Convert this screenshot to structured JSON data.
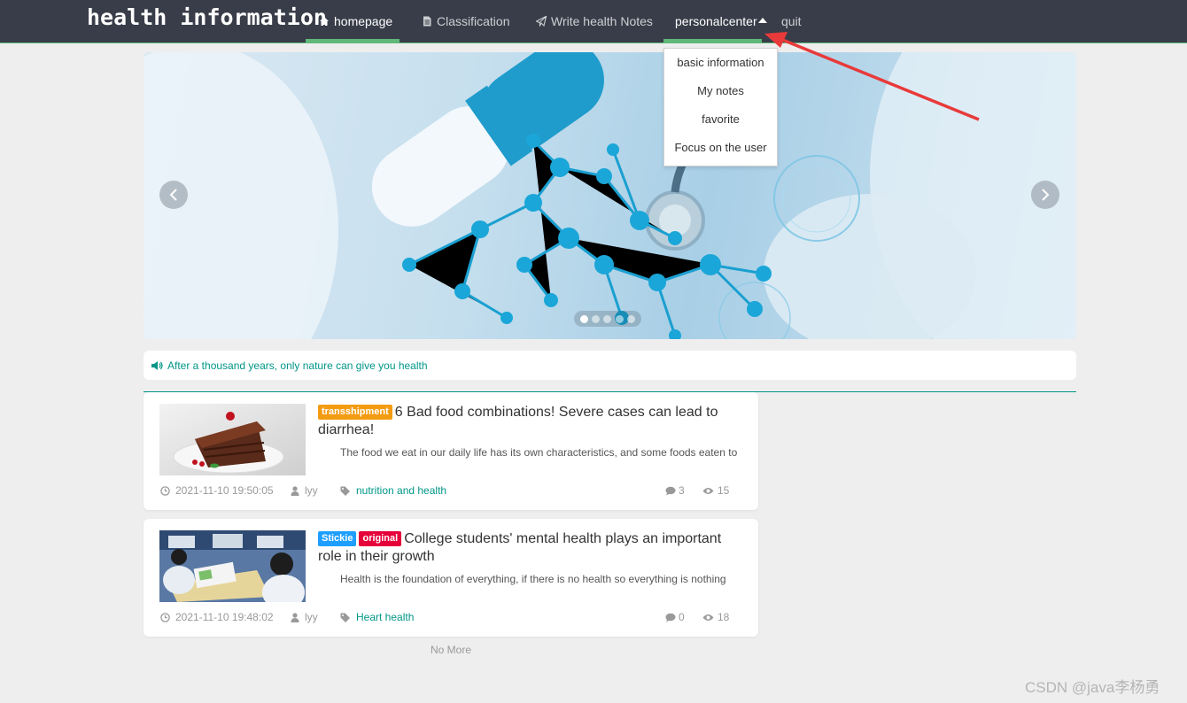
{
  "header": {
    "logo": "health information",
    "nav": [
      {
        "label": "homepage",
        "icon": "home-icon",
        "active": true
      },
      {
        "label": "Classification",
        "icon": "file-icon"
      },
      {
        "label": "Write health Notes",
        "icon": "paper-plane-icon"
      },
      {
        "label": "personalcenter",
        "icon": "caret-up-icon"
      },
      {
        "label": "quit"
      }
    ]
  },
  "dropdown": {
    "items": [
      "basic information",
      "My notes",
      "favorite",
      "Focus on the user"
    ]
  },
  "notice": {
    "text": "After a thousand years, only nature can give you health",
    "icon": "volume-icon"
  },
  "articles": [
    {
      "tags": [
        "transshipment"
      ],
      "title": "6 Bad food combinations! Severe cases can lead to diarrhea!",
      "desc": "The food we eat in our daily life has its own characteristics, and some foods eaten to",
      "time": "2021-11-10 19:50:05",
      "author": "lyy",
      "category": "nutrition and health",
      "comments": "3",
      "views": "15"
    },
    {
      "tags": [
        "Stickie",
        "original"
      ],
      "title": "College students' mental health plays an important role in their growth",
      "desc": "Health is the foundation of everything, if there is no health so everything is nothing",
      "time": "2021-11-10 19:48:02",
      "author": "lyy",
      "category": "Heart health",
      "comments": "0",
      "views": "18"
    }
  ],
  "no_more": "No More",
  "watermark": "CSDN @java李杨勇",
  "colors": {
    "header_bg": "#393d49",
    "accent_green": "#5fb878",
    "teal": "#009688",
    "tag_orange": "#f39c12",
    "tag_blue": "#1e9fff",
    "tag_red": "#e5003a",
    "annotation_red": "#e83a3a"
  }
}
